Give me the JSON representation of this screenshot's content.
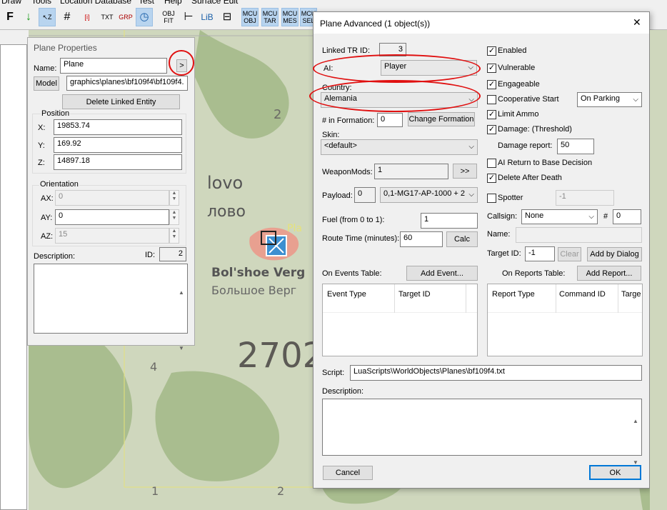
{
  "menu": [
    "Draw",
    "Tools",
    "Location Database",
    "Test",
    "Help",
    "Surface Edit"
  ],
  "toolbar": [
    {
      "label": "F",
      "name": "font-icon"
    },
    {
      "label": "↓",
      "name": "download-arrow-icon"
    },
    {
      "label": "↖Z",
      "name": "select-z-icon"
    },
    {
      "label": "#",
      "name": "grid-icon"
    },
    {
      "label": "[i]",
      "name": "info-icon"
    },
    {
      "label": "TXT",
      "name": "txt-icon"
    },
    {
      "label": "GRP",
      "name": "grp-icon"
    },
    {
      "label": "◷",
      "name": "clock-icon"
    },
    {
      "label": "OBJ FIT",
      "name": "obj-fit-icon"
    },
    {
      "label": "⊢",
      "name": "align-icon"
    },
    {
      "label": "LiB",
      "name": "library-icon"
    },
    {
      "label": "⊟",
      "name": "columns-icon"
    },
    {
      "label": "MCU OBJ",
      "name": "mcu-obj-icon"
    },
    {
      "label": "MCU TAR",
      "name": "mcu-tar-icon"
    },
    {
      "label": "MCU MES",
      "name": "mcu-mes-icon"
    },
    {
      "label": "MCU SEL",
      "name": "mcu-sel-icon"
    }
  ],
  "map": {
    "labels": [
      "2",
      "lovo",
      "лово",
      "Bol'shoe Verg",
      "Большое Верг",
      "2702",
      "4",
      "1",
      "2",
      "Pla"
    ],
    "colors": {
      "land": "#cfd7bd",
      "forest": "#a9bd8f",
      "red_area": "#e8a090",
      "icon": "#3c8fd0"
    }
  },
  "props": {
    "title": "Plane Properties",
    "name_label": "Name:",
    "name_value": "Plane",
    "more_btn": ">",
    "model_btn": "Model",
    "model_value": "graphics\\planes\\bf109f4\\bf109f4.",
    "delete_btn": "Delete Linked Entity",
    "position_label": "Position",
    "x_label": "X:",
    "x_value": "19853.74",
    "y_label": "Y:",
    "y_value": "169.92",
    "z_label": "Z:",
    "z_value": "14897.18",
    "orientation_label": "Orientation",
    "ax_label": "AX:",
    "ax_value": "0",
    "ay_label": "AY:",
    "ay_value": "0",
    "az_label": "AZ:",
    "az_value": "15",
    "desc_label": "Description:",
    "id_label": "ID:",
    "id_value": "2"
  },
  "adv": {
    "title": "Plane Advanced (1 object(s))",
    "close": "✕",
    "linked_label": "Linked TR ID:",
    "linked_value": "3",
    "ai_label": "AI:",
    "ai_value": "Player",
    "country_label": "Country:",
    "country_value": "Alemania",
    "formation_label": "# in Formation:",
    "formation_value": "0",
    "change_formation_btn": "Change Formation",
    "skin_label": "Skin:",
    "skin_value": "<default>",
    "weaponmods_label": "WeaponMods:",
    "weaponmods_value": "1",
    "weaponmods_btn": ">>",
    "payload_label": "Payload:",
    "payload_value": "0",
    "payload_combo": "0,1-MG17-AP-1000 + 2",
    "fuel_label": "Fuel (from 0 to 1):",
    "fuel_value": "1",
    "route_label": "Route Time (minutes):",
    "route_value": "60",
    "calc_btn": "Calc",
    "enabled": "Enabled",
    "vulnerable": "Vulnerable",
    "engageable": "Engageable",
    "coop_start": "Cooperative Start",
    "on_parking": "On Parking",
    "limit_ammo": "Limit Ammo",
    "damage_threshold": "Damage: (Threshold)",
    "damage_report_label": "Damage report:",
    "damage_report_value": "50",
    "ai_return": "AI Return to Base Decision",
    "delete_after_death": "Delete After Death",
    "spotter": "Spotter",
    "spotter_value": "-1",
    "callsign_label": "Callsign:",
    "callsign_value": "None",
    "hash_label": "#",
    "hash_value": "0",
    "name_label": "Name:",
    "target_id_label": "Target ID:",
    "target_id_value": "-1",
    "clear_btn": "Clear",
    "add_by_dialog_btn": "Add by Dialog",
    "on_events_label": "On Events Table:",
    "add_event_btn": "Add Event...",
    "on_reports_label": "On Reports Table:",
    "add_report_btn": "Add Report...",
    "events_cols": [
      "Event Type",
      "Target ID"
    ],
    "reports_cols": [
      "Report Type",
      "Command ID",
      "Targe"
    ],
    "script_label": "Script:",
    "script_value": "LuaScripts\\WorldObjects\\Planes\\bf109f4.txt",
    "desc_label": "Description:",
    "cancel_btn": "Cancel",
    "ok_btn": "OK",
    "check_states": {
      "enabled": true,
      "vulnerable": true,
      "engageable": true,
      "coop_start": false,
      "limit_ammo": true,
      "damage_threshold": true,
      "ai_return": false,
      "delete_after_death": true,
      "spotter": false
    }
  }
}
